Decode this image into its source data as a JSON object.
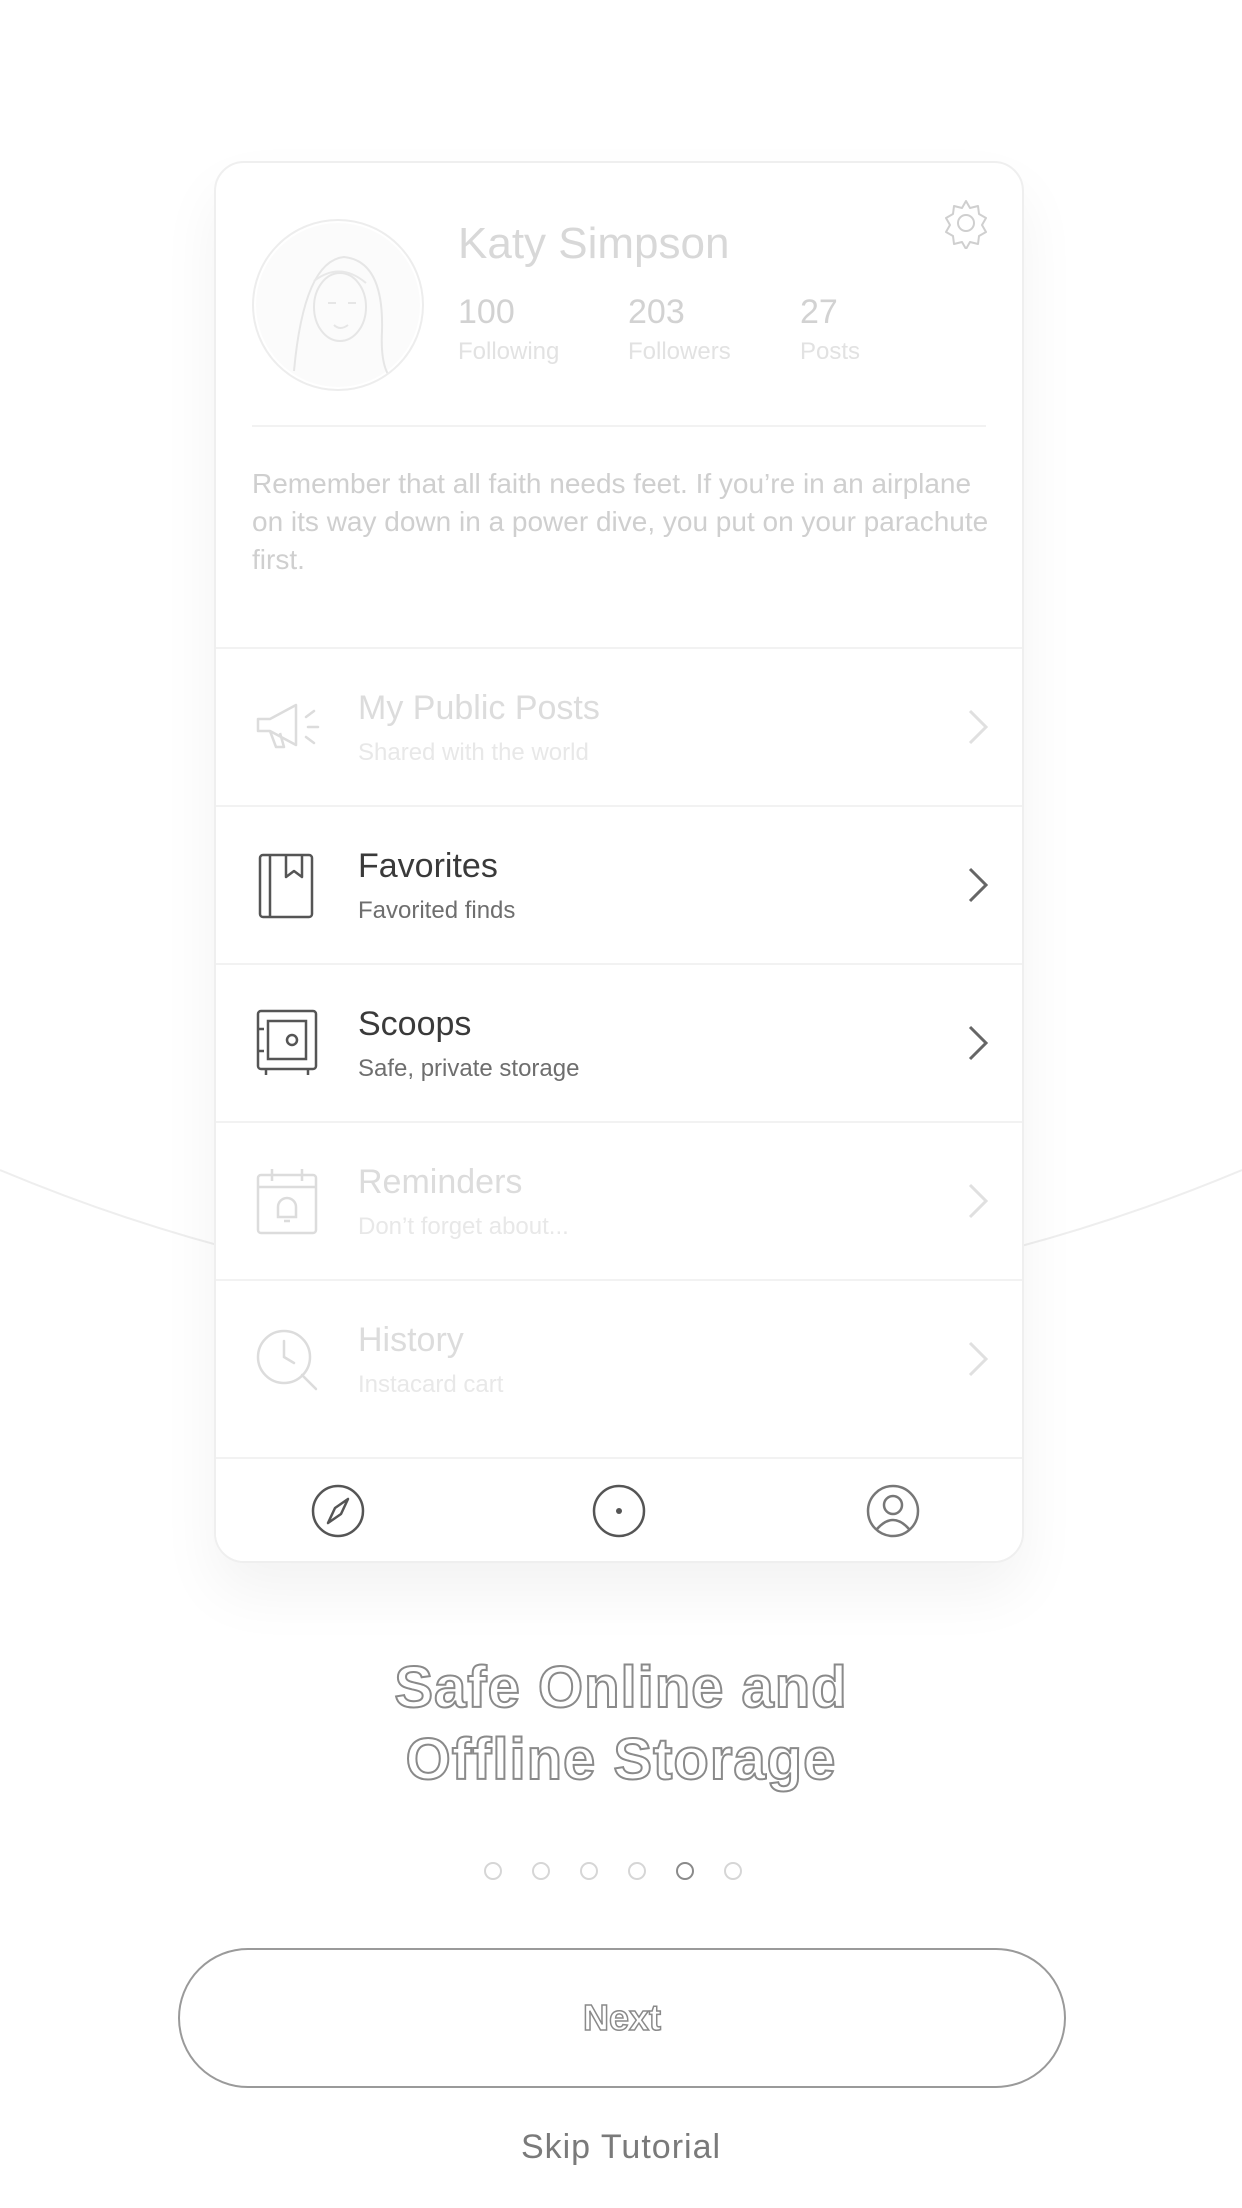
{
  "profile": {
    "name": "Katy Simpson",
    "stats": [
      {
        "value": "100",
        "label": "Following"
      },
      {
        "value": "203",
        "label": "Followers"
      },
      {
        "value": "27",
        "label": "Posts"
      }
    ],
    "bio": "Remember that all faith needs feet. If you’re in an airplane on its way down in a power dive, you put on your parachute first."
  },
  "menu": [
    {
      "title": "My Public Posts",
      "subtitle": "Shared with the world",
      "icon": "megaphone-icon",
      "state": "faded"
    },
    {
      "title": "Favorites",
      "subtitle": "Favorited finds",
      "icon": "bookmark-book-icon",
      "state": "active"
    },
    {
      "title": "Scoops",
      "subtitle": "Safe, private storage",
      "icon": "safe-icon",
      "state": "active"
    },
    {
      "title": "Reminders",
      "subtitle": "Don’t forget about...",
      "icon": "calendar-bell-icon",
      "state": "faded"
    },
    {
      "title": "History",
      "subtitle": "Instacard cart",
      "icon": "clock-search-icon",
      "state": "faded"
    }
  ],
  "tabbar": [
    "compass-icon",
    "record-icon",
    "user-icon"
  ],
  "onboarding": {
    "headline_line1": "Safe Online and",
    "headline_line2": "Offline Storage",
    "page_count": 6,
    "current_page": 5,
    "next_label": "Next",
    "skip_label": "Skip Tutorial"
  }
}
